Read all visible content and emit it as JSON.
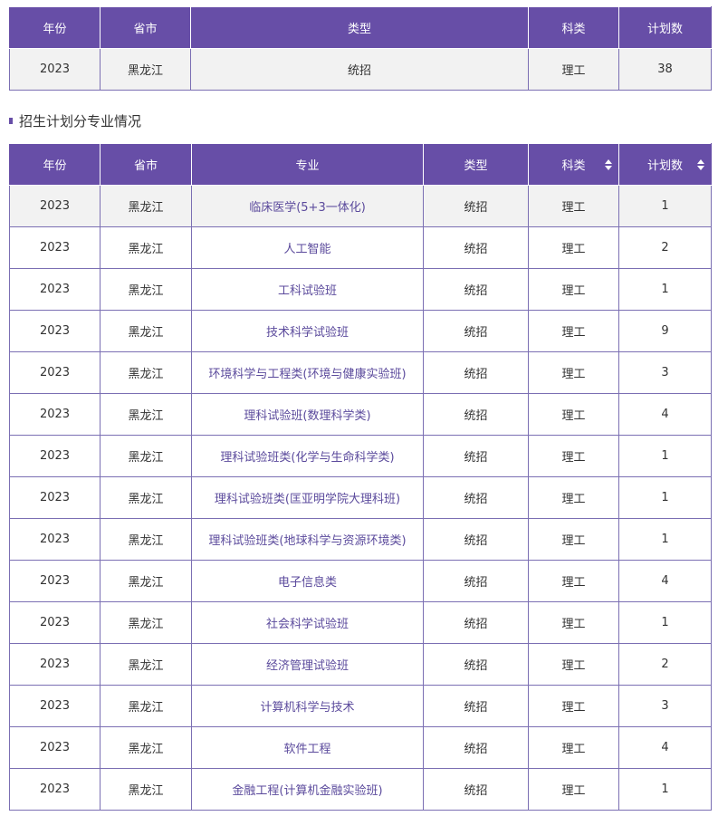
{
  "summary": {
    "headers": [
      "年份",
      "省市",
      "类型",
      "科类",
      "计划数"
    ],
    "row": [
      "2023",
      "黑龙江",
      "统招",
      "理工",
      "38"
    ]
  },
  "section_title": "招生计划分专业情况",
  "majors": {
    "headers": [
      "年份",
      "省市",
      "专业",
      "类型",
      "科类",
      "计划数"
    ],
    "sortable_icons": [
      "sort-icon",
      "sort-icon"
    ],
    "rows": [
      [
        "2023",
        "黑龙江",
        "临床医学(5+3一体化)",
        "统招",
        "理工",
        "1"
      ],
      [
        "2023",
        "黑龙江",
        "人工智能",
        "统招",
        "理工",
        "2"
      ],
      [
        "2023",
        "黑龙江",
        "工科试验班",
        "统招",
        "理工",
        "1"
      ],
      [
        "2023",
        "黑龙江",
        "技术科学试验班",
        "统招",
        "理工",
        "9"
      ],
      [
        "2023",
        "黑龙江",
        "环境科学与工程类(环境与健康实验班)",
        "统招",
        "理工",
        "3"
      ],
      [
        "2023",
        "黑龙江",
        "理科试验班(数理科学类)",
        "统招",
        "理工",
        "4"
      ],
      [
        "2023",
        "黑龙江",
        "理科试验班类(化学与生命科学类)",
        "统招",
        "理工",
        "1"
      ],
      [
        "2023",
        "黑龙江",
        "理科试验班类(匡亚明学院大理科班)",
        "统招",
        "理工",
        "1"
      ],
      [
        "2023",
        "黑龙江",
        "理科试验班类(地球科学与资源环境类)",
        "统招",
        "理工",
        "1"
      ],
      [
        "2023",
        "黑龙江",
        "电子信息类",
        "统招",
        "理工",
        "4"
      ],
      [
        "2023",
        "黑龙江",
        "社会科学试验班",
        "统招",
        "理工",
        "1"
      ],
      [
        "2023",
        "黑龙江",
        "经济管理试验班",
        "统招",
        "理工",
        "2"
      ],
      [
        "2023",
        "黑龙江",
        "计算机科学与技术",
        "统招",
        "理工",
        "3"
      ],
      [
        "2023",
        "黑龙江",
        "软件工程",
        "统招",
        "理工",
        "4"
      ],
      [
        "2023",
        "黑龙江",
        "金融工程(计算机金融实验班)",
        "统招",
        "理工",
        "1"
      ]
    ]
  },
  "colors": {
    "header_bg": "#674ea7",
    "border": "#7b6fb3",
    "major_text": "#5b4a9c"
  }
}
